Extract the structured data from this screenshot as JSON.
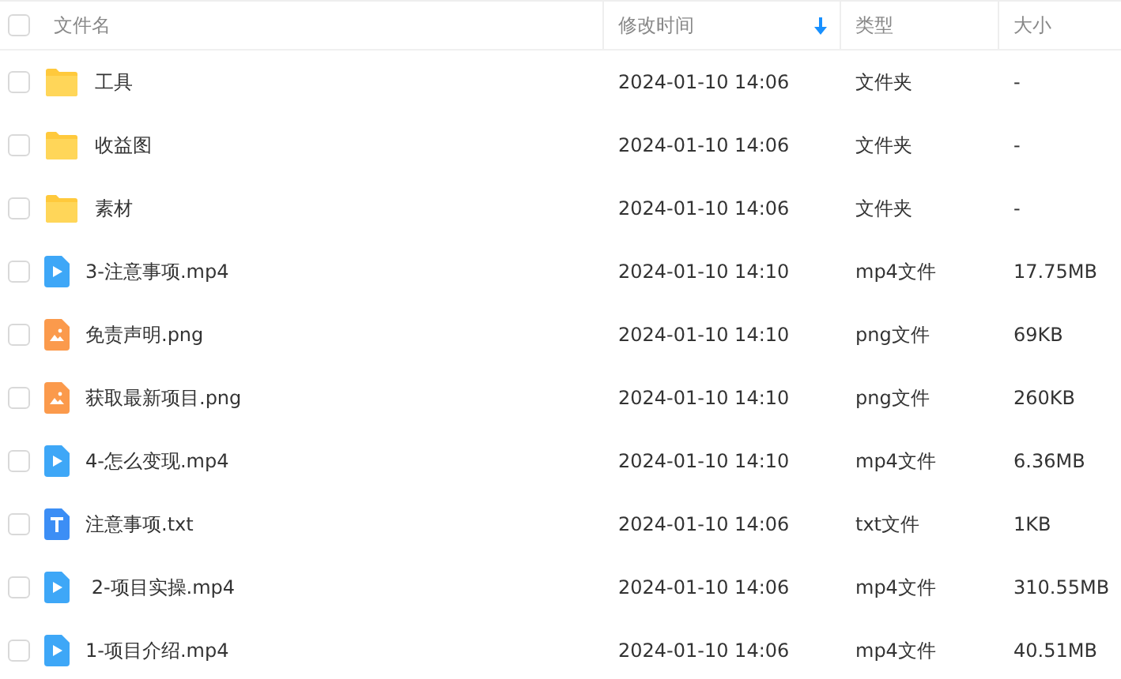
{
  "table": {
    "select_all": {
      "checked": false
    },
    "columns": [
      {
        "label": "文件名",
        "sorted": false
      },
      {
        "label": "修改时间",
        "sorted": true
      },
      {
        "label": "类型",
        "sorted": false
      },
      {
        "label": "大小",
        "sorted": false
      }
    ],
    "rows": [
      {
        "kind": "folder",
        "checked": false,
        "name": "工具",
        "modified": "2024-01-10 14:06",
        "type": "文件夹",
        "size": "-"
      },
      {
        "kind": "folder",
        "checked": false,
        "name": "收益图",
        "modified": "2024-01-10 14:06",
        "type": "文件夹",
        "size": "-"
      },
      {
        "kind": "folder",
        "checked": false,
        "name": "素材",
        "modified": "2024-01-10 14:06",
        "type": "文件夹",
        "size": "-"
      },
      {
        "kind": "video",
        "checked": false,
        "name": "3-注意事项.mp4",
        "modified": "2024-01-10 14:10",
        "type": "mp4文件",
        "size": "17.75MB"
      },
      {
        "kind": "image",
        "checked": false,
        "name": "免责声明.png",
        "modified": "2024-01-10 14:10",
        "type": "png文件",
        "size": "69KB"
      },
      {
        "kind": "image",
        "checked": false,
        "name": "获取最新项目.png",
        "modified": "2024-01-10 14:10",
        "type": "png文件",
        "size": "260KB"
      },
      {
        "kind": "video",
        "checked": false,
        "name": "4-怎么变现.mp4",
        "modified": "2024-01-10 14:10",
        "type": "mp4文件",
        "size": "6.36MB"
      },
      {
        "kind": "text",
        "checked": false,
        "name": "注意事项.txt",
        "modified": "2024-01-10 14:06",
        "type": "txt文件",
        "size": "1KB"
      },
      {
        "kind": "video",
        "checked": false,
        "name": " 2-项目实操.mp4",
        "modified": "2024-01-10 14:06",
        "type": "mp4文件",
        "size": "310.55MB"
      },
      {
        "kind": "video",
        "checked": false,
        "name": "1-项目介绍.mp4",
        "modified": "2024-01-10 14:06",
        "type": "mp4文件",
        "size": "40.51MB"
      }
    ]
  }
}
